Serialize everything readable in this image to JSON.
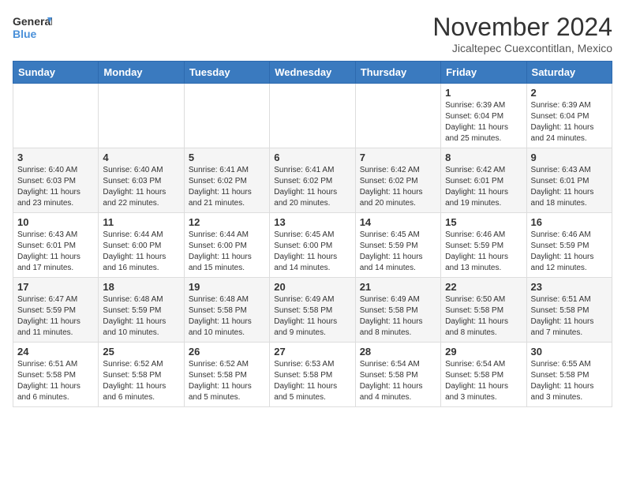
{
  "header": {
    "logo_general": "General",
    "logo_blue": "Blue",
    "month_title": "November 2024",
    "location": "Jicaltepec Cuexcontitlan, Mexico"
  },
  "weekdays": [
    "Sunday",
    "Monday",
    "Tuesday",
    "Wednesday",
    "Thursday",
    "Friday",
    "Saturday"
  ],
  "weeks": [
    [
      {
        "day": "",
        "info": ""
      },
      {
        "day": "",
        "info": ""
      },
      {
        "day": "",
        "info": ""
      },
      {
        "day": "",
        "info": ""
      },
      {
        "day": "",
        "info": ""
      },
      {
        "day": "1",
        "info": "Sunrise: 6:39 AM\nSunset: 6:04 PM\nDaylight: 11 hours and 25 minutes."
      },
      {
        "day": "2",
        "info": "Sunrise: 6:39 AM\nSunset: 6:04 PM\nDaylight: 11 hours and 24 minutes."
      }
    ],
    [
      {
        "day": "3",
        "info": "Sunrise: 6:40 AM\nSunset: 6:03 PM\nDaylight: 11 hours and 23 minutes."
      },
      {
        "day": "4",
        "info": "Sunrise: 6:40 AM\nSunset: 6:03 PM\nDaylight: 11 hours and 22 minutes."
      },
      {
        "day": "5",
        "info": "Sunrise: 6:41 AM\nSunset: 6:02 PM\nDaylight: 11 hours and 21 minutes."
      },
      {
        "day": "6",
        "info": "Sunrise: 6:41 AM\nSunset: 6:02 PM\nDaylight: 11 hours and 20 minutes."
      },
      {
        "day": "7",
        "info": "Sunrise: 6:42 AM\nSunset: 6:02 PM\nDaylight: 11 hours and 20 minutes."
      },
      {
        "day": "8",
        "info": "Sunrise: 6:42 AM\nSunset: 6:01 PM\nDaylight: 11 hours and 19 minutes."
      },
      {
        "day": "9",
        "info": "Sunrise: 6:43 AM\nSunset: 6:01 PM\nDaylight: 11 hours and 18 minutes."
      }
    ],
    [
      {
        "day": "10",
        "info": "Sunrise: 6:43 AM\nSunset: 6:01 PM\nDaylight: 11 hours and 17 minutes."
      },
      {
        "day": "11",
        "info": "Sunrise: 6:44 AM\nSunset: 6:00 PM\nDaylight: 11 hours and 16 minutes."
      },
      {
        "day": "12",
        "info": "Sunrise: 6:44 AM\nSunset: 6:00 PM\nDaylight: 11 hours and 15 minutes."
      },
      {
        "day": "13",
        "info": "Sunrise: 6:45 AM\nSunset: 6:00 PM\nDaylight: 11 hours and 14 minutes."
      },
      {
        "day": "14",
        "info": "Sunrise: 6:45 AM\nSunset: 5:59 PM\nDaylight: 11 hours and 14 minutes."
      },
      {
        "day": "15",
        "info": "Sunrise: 6:46 AM\nSunset: 5:59 PM\nDaylight: 11 hours and 13 minutes."
      },
      {
        "day": "16",
        "info": "Sunrise: 6:46 AM\nSunset: 5:59 PM\nDaylight: 11 hours and 12 minutes."
      }
    ],
    [
      {
        "day": "17",
        "info": "Sunrise: 6:47 AM\nSunset: 5:59 PM\nDaylight: 11 hours and 11 minutes."
      },
      {
        "day": "18",
        "info": "Sunrise: 6:48 AM\nSunset: 5:59 PM\nDaylight: 11 hours and 10 minutes."
      },
      {
        "day": "19",
        "info": "Sunrise: 6:48 AM\nSunset: 5:58 PM\nDaylight: 11 hours and 10 minutes."
      },
      {
        "day": "20",
        "info": "Sunrise: 6:49 AM\nSunset: 5:58 PM\nDaylight: 11 hours and 9 minutes."
      },
      {
        "day": "21",
        "info": "Sunrise: 6:49 AM\nSunset: 5:58 PM\nDaylight: 11 hours and 8 minutes."
      },
      {
        "day": "22",
        "info": "Sunrise: 6:50 AM\nSunset: 5:58 PM\nDaylight: 11 hours and 8 minutes."
      },
      {
        "day": "23",
        "info": "Sunrise: 6:51 AM\nSunset: 5:58 PM\nDaylight: 11 hours and 7 minutes."
      }
    ],
    [
      {
        "day": "24",
        "info": "Sunrise: 6:51 AM\nSunset: 5:58 PM\nDaylight: 11 hours and 6 minutes."
      },
      {
        "day": "25",
        "info": "Sunrise: 6:52 AM\nSunset: 5:58 PM\nDaylight: 11 hours and 6 minutes."
      },
      {
        "day": "26",
        "info": "Sunrise: 6:52 AM\nSunset: 5:58 PM\nDaylight: 11 hours and 5 minutes."
      },
      {
        "day": "27",
        "info": "Sunrise: 6:53 AM\nSunset: 5:58 PM\nDaylight: 11 hours and 5 minutes."
      },
      {
        "day": "28",
        "info": "Sunrise: 6:54 AM\nSunset: 5:58 PM\nDaylight: 11 hours and 4 minutes."
      },
      {
        "day": "29",
        "info": "Sunrise: 6:54 AM\nSunset: 5:58 PM\nDaylight: 11 hours and 3 minutes."
      },
      {
        "day": "30",
        "info": "Sunrise: 6:55 AM\nSunset: 5:58 PM\nDaylight: 11 hours and 3 minutes."
      }
    ]
  ]
}
